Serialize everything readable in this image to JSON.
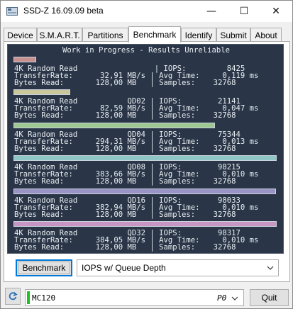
{
  "window": {
    "title": "SSD-Z 16.09.09 beta",
    "minimize": "—",
    "maximize": "☐",
    "close": "✕"
  },
  "tabs": [
    {
      "label": "Device"
    },
    {
      "label": "S.M.A.R.T."
    },
    {
      "label": "Partitions"
    },
    {
      "label": "Benchmark"
    },
    {
      "label": "Identify"
    },
    {
      "label": "Submit"
    },
    {
      "label": "About"
    }
  ],
  "active_tab": "Benchmark",
  "results": {
    "banner": "Work in Progress - Results Unreliable",
    "blocks": [
      {
        "bar_color": "#c79190",
        "bar_fraction": 0.086,
        "line1": "4K Random Read                 | IOPS:         8425",
        "line2": "TransferRate:      32,91 MB/s | Avg Time:     0,119 ms",
        "line3": "Bytes Read:       128,00 MB   | Samples:    32768"
      },
      {
        "bar_color": "#cbc79a",
        "bar_fraction": 0.215,
        "line1": "4K Random Read           QD02 | IOPS:        21141",
        "line2": "TransferRate:      82,59 MB/s | Avg Time:     0,047 ms",
        "line3": "Bytes Read:       128,00 MB   | Samples:    32768"
      },
      {
        "bar_color": "#9fc791",
        "bar_fraction": 0.766,
        "line1": "4K Random Read           QD04 | IOPS:        75344",
        "line2": "TransferRate:     294,31 MB/s | Avg Time:     0,013 ms",
        "line3": "Bytes Read:       128,00 MB   | Samples:    32768"
      },
      {
        "bar_color": "#8fc6c6",
        "bar_fraction": 0.999,
        "line1": "4K Random Read           QD08 | IOPS:        98215",
        "line2": "TransferRate:     383,66 MB/s | Avg Time:     0,010 ms",
        "line3": "Bytes Read:       128,00 MB   | Samples:    32768"
      },
      {
        "bar_color": "#9a94c6",
        "bar_fraction": 0.997,
        "line1": "4K Random Read           QD16 | IOPS:        98033",
        "line2": "TransferRate:     382,94 MB/s | Avg Time:     0,010 ms",
        "line3": "Bytes Read:       128,00 MB   | Samples:    32768"
      },
      {
        "bar_color": "#c796c4",
        "bar_fraction": 1.0,
        "line1": "4K Random Read           QD32 | IOPS:        98317",
        "line2": "TransferRate:     384,05 MB/s | Avg Time:     0,010 ms",
        "line3": "Bytes Read:       128,00 MB   | Samples:    32768"
      }
    ]
  },
  "controls": {
    "benchmark_button": "Benchmark",
    "mode_select": "IOPS w/ Queue Depth"
  },
  "footer": {
    "drive_name": "MC120",
    "drive_port": "P0",
    "quit_button": "Quit"
  },
  "colors": {
    "panel_bg": "#2a3647",
    "drive_status": "#1ec11e",
    "accent": "#0078d7"
  }
}
